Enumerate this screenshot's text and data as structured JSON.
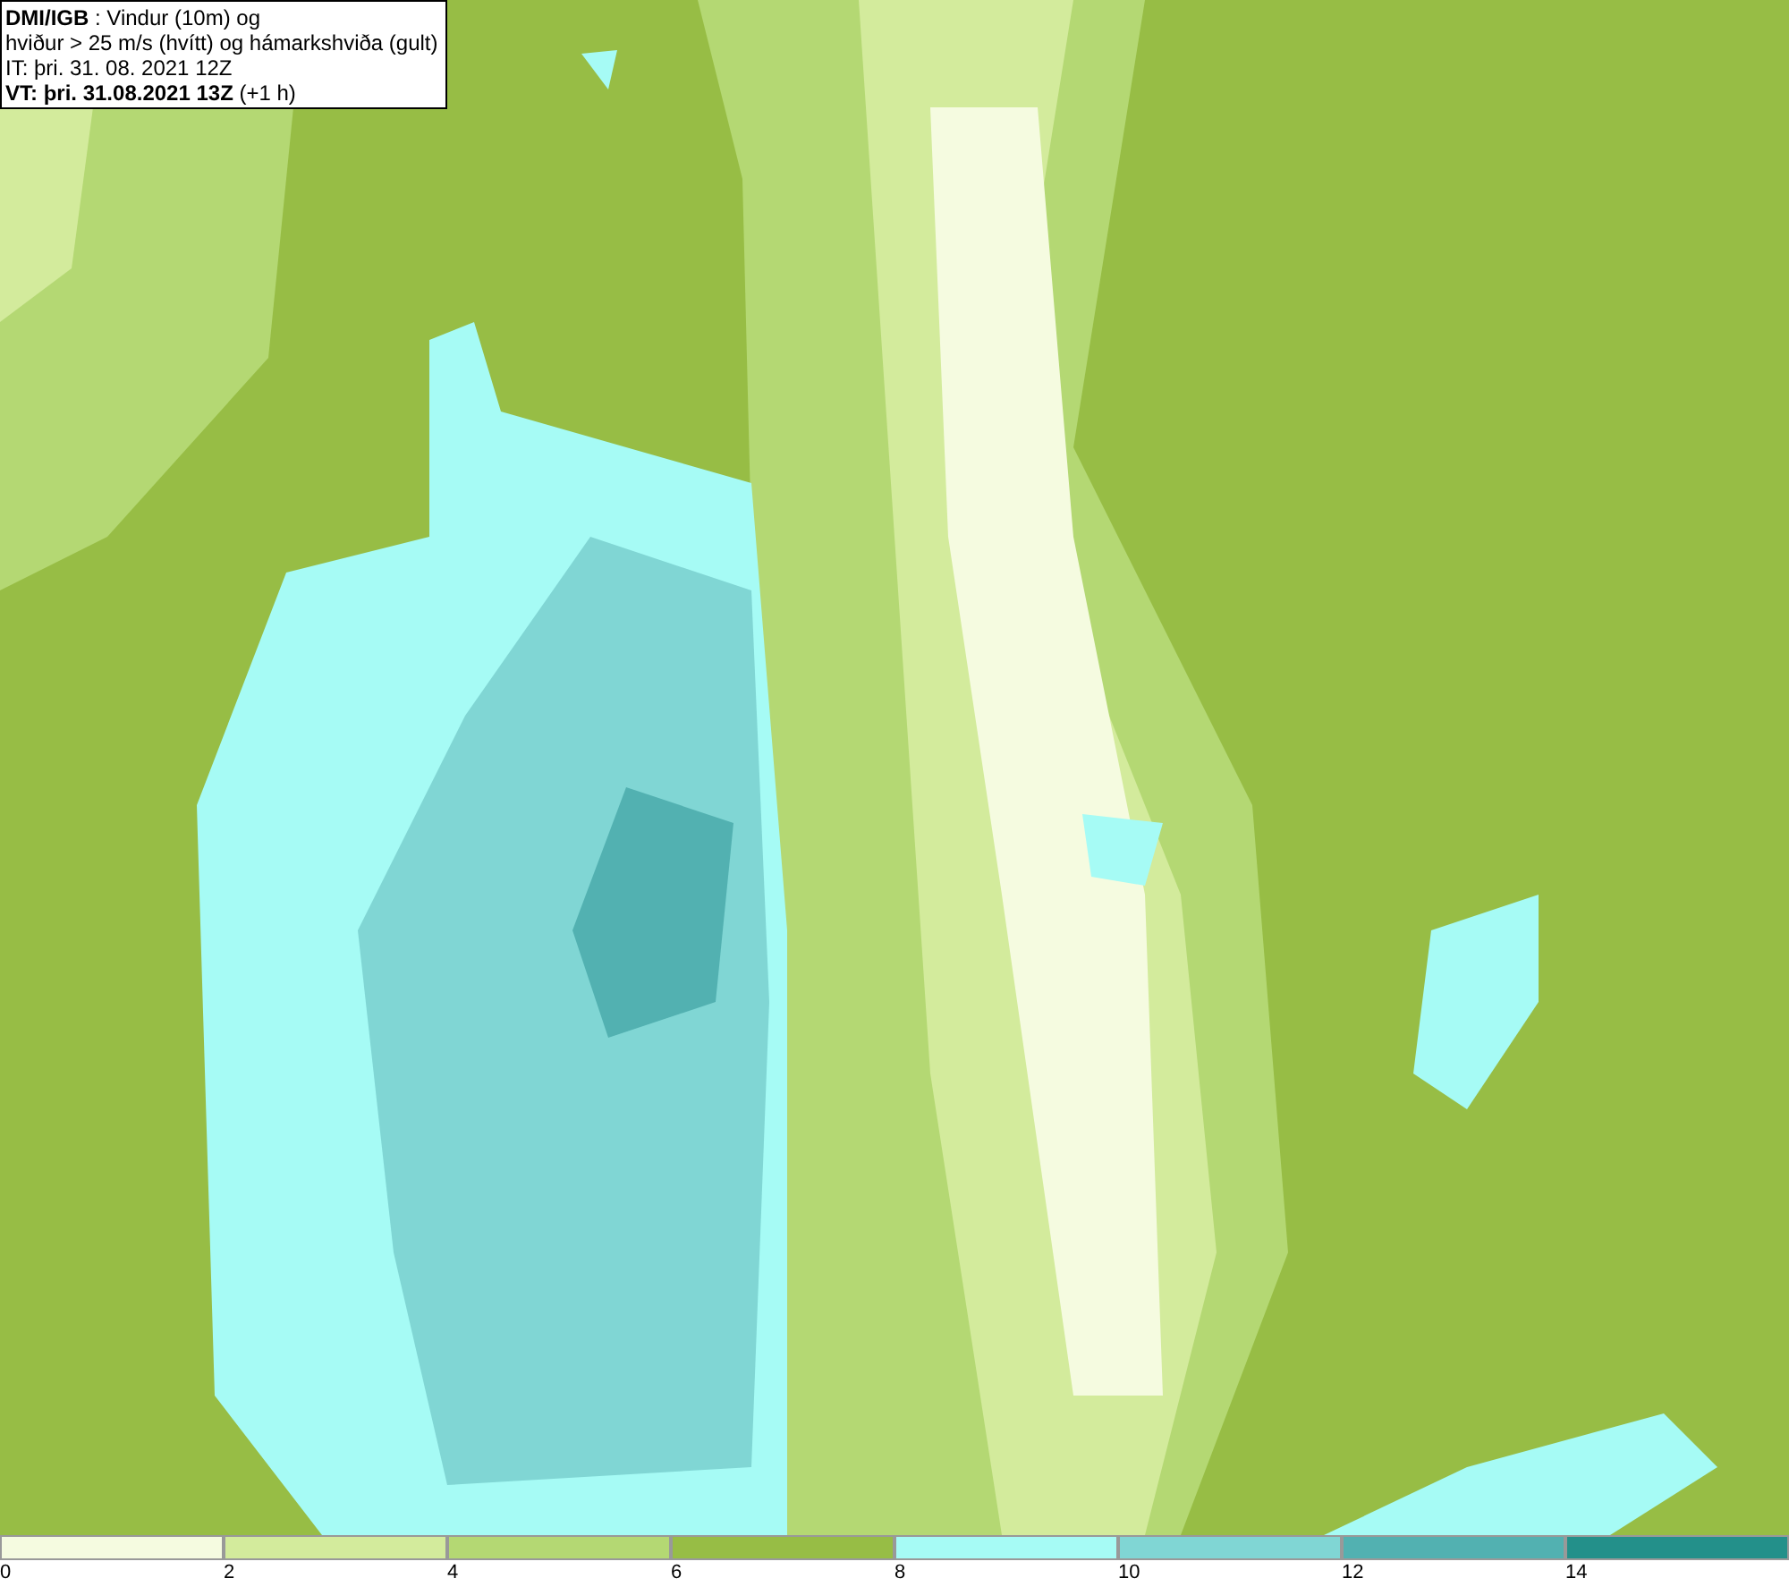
{
  "info_box": {
    "lines": [
      "**DMI/IGB** : Vindur (10m) og",
      "hviður > 25 m/s (hvítt) og hámarkshviða (gult)",
      "IT: þri. 31. 08. 2021 12Z",
      "**VT: þri. 31.08.2021 13Z** (+1 h)"
    ]
  },
  "legend": {
    "segments": [
      {
        "color": "#f5fbe0"
      },
      {
        "color": "#d3eb9c"
      },
      {
        "color": "#b4d873"
      },
      {
        "color": "#97bd45"
      },
      {
        "color": "#a6fbf5"
      },
      {
        "color": "#80d6d4"
      },
      {
        "color": "#52b1b1"
      },
      {
        "color": "#23908a"
      }
    ],
    "ticks": [
      "0",
      "2",
      "4",
      "6",
      "8",
      "10",
      "12",
      "14"
    ]
  }
}
